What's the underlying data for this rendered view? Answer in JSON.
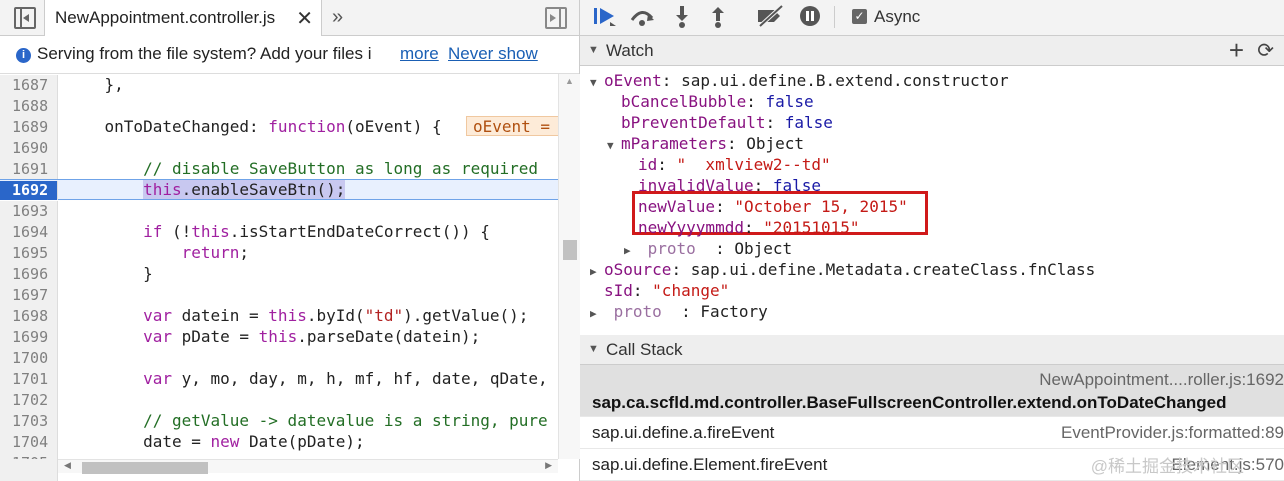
{
  "left": {
    "file_tab": "NewAppointment.controller.js",
    "close_glyph": "✕",
    "more_glyph": "»",
    "info_text": "Serving from the file system? Add your files i",
    "info_more": "more",
    "info_never": "Never show",
    "lines": [
      {
        "n": "1687",
        "code": "    },"
      },
      {
        "n": "1688",
        "code": ""
      },
      {
        "n": "1689",
        "code": "    onToDateChanged: function(oEvent) {"
      },
      {
        "n": "1690",
        "code": ""
      },
      {
        "n": "1691",
        "code": "        // disable SaveButton as long as required"
      },
      {
        "n": "1692",
        "code": "        this.enableSaveBtn();"
      },
      {
        "n": "1693",
        "code": ""
      },
      {
        "n": "1694",
        "code": "        if (!this.isStartEndDateCorrect()) {"
      },
      {
        "n": "1695",
        "code": "            return;"
      },
      {
        "n": "1696",
        "code": "        }"
      },
      {
        "n": "1697",
        "code": ""
      },
      {
        "n": "1698",
        "code": "        var datein = this.byId(\"td\").getValue();"
      },
      {
        "n": "1699",
        "code": "        var pDate = this.parseDate(datein);"
      },
      {
        "n": "1700",
        "code": ""
      },
      {
        "n": "1701",
        "code": "        var y, mo, day, m, h, mf, hf, date, qDate,"
      },
      {
        "n": "1702",
        "code": ""
      },
      {
        "n": "1703",
        "code": "        // getValue -> datevalue is a string, pure"
      },
      {
        "n": "1704",
        "code": "        date = new Date(pDate);"
      },
      {
        "n": "1705",
        "code": ""
      }
    ],
    "inline_value": "oEvent = "
  },
  "toolbar": {
    "async_label": "Async",
    "async_checked": true
  },
  "watch": {
    "title": "Watch",
    "rows": [
      {
        "indent": 0,
        "tri": "▼",
        "key": "oEvent",
        "val": "sap.ui.define.B.extend.constructor",
        "vtype": "plain"
      },
      {
        "indent": 1,
        "tri": "",
        "key": "bCancelBubble",
        "val": "false",
        "vtype": "kw"
      },
      {
        "indent": 1,
        "tri": "",
        "key": "bPreventDefault",
        "val": "false",
        "vtype": "kw"
      },
      {
        "indent": 1,
        "tri": "▼",
        "key": "mParameters",
        "val": "Object",
        "vtype": "plain"
      },
      {
        "indent": 2,
        "tri": "",
        "key": "id",
        "val": "\"  xmlview2--td\"",
        "vtype": "str"
      },
      {
        "indent": 2,
        "tri": "",
        "key": "invalidValue",
        "val": "false",
        "vtype": "kw"
      },
      {
        "indent": 2,
        "tri": "",
        "key": "newValue",
        "val": "\"October 15, 2015\"",
        "vtype": "str"
      },
      {
        "indent": 2,
        "tri": "",
        "key": "newYyyymmdd",
        "val": "\"20151015\"",
        "vtype": "str"
      },
      {
        "indent": 2,
        "tri": "▶",
        "key": " proto  ",
        "val": "Object",
        "vtype": "plain",
        "dim": true
      },
      {
        "indent": 0,
        "tri": "▶",
        "key": "oSource",
        "val": "sap.ui.define.Metadata.createClass.fnClass",
        "vtype": "plain"
      },
      {
        "indent": 0,
        "tri": "",
        "key": "sId",
        "val": "\"change\"",
        "vtype": "str"
      },
      {
        "indent": 0,
        "tri": "▶",
        "key": " proto  ",
        "val": "Factory",
        "vtype": "plain",
        "dim": true
      }
    ]
  },
  "callstack": {
    "title": "Call Stack",
    "frames": [
      {
        "fn": "sap.ca.scfld.md.controller.BaseFullscreenController.extend.onToDateChanged",
        "loc": "NewAppointment....roller.js:1692",
        "selected": true
      },
      {
        "fn": "sap.ui.define.a.fireEvent",
        "loc": "EventProvider.js:formatted:89",
        "selected": false
      },
      {
        "fn": "sap.ui.define.Element.fireEvent",
        "loc": "Element.js:570",
        "selected": false
      }
    ]
  },
  "watermark": "@稀土掘金技术社区"
}
